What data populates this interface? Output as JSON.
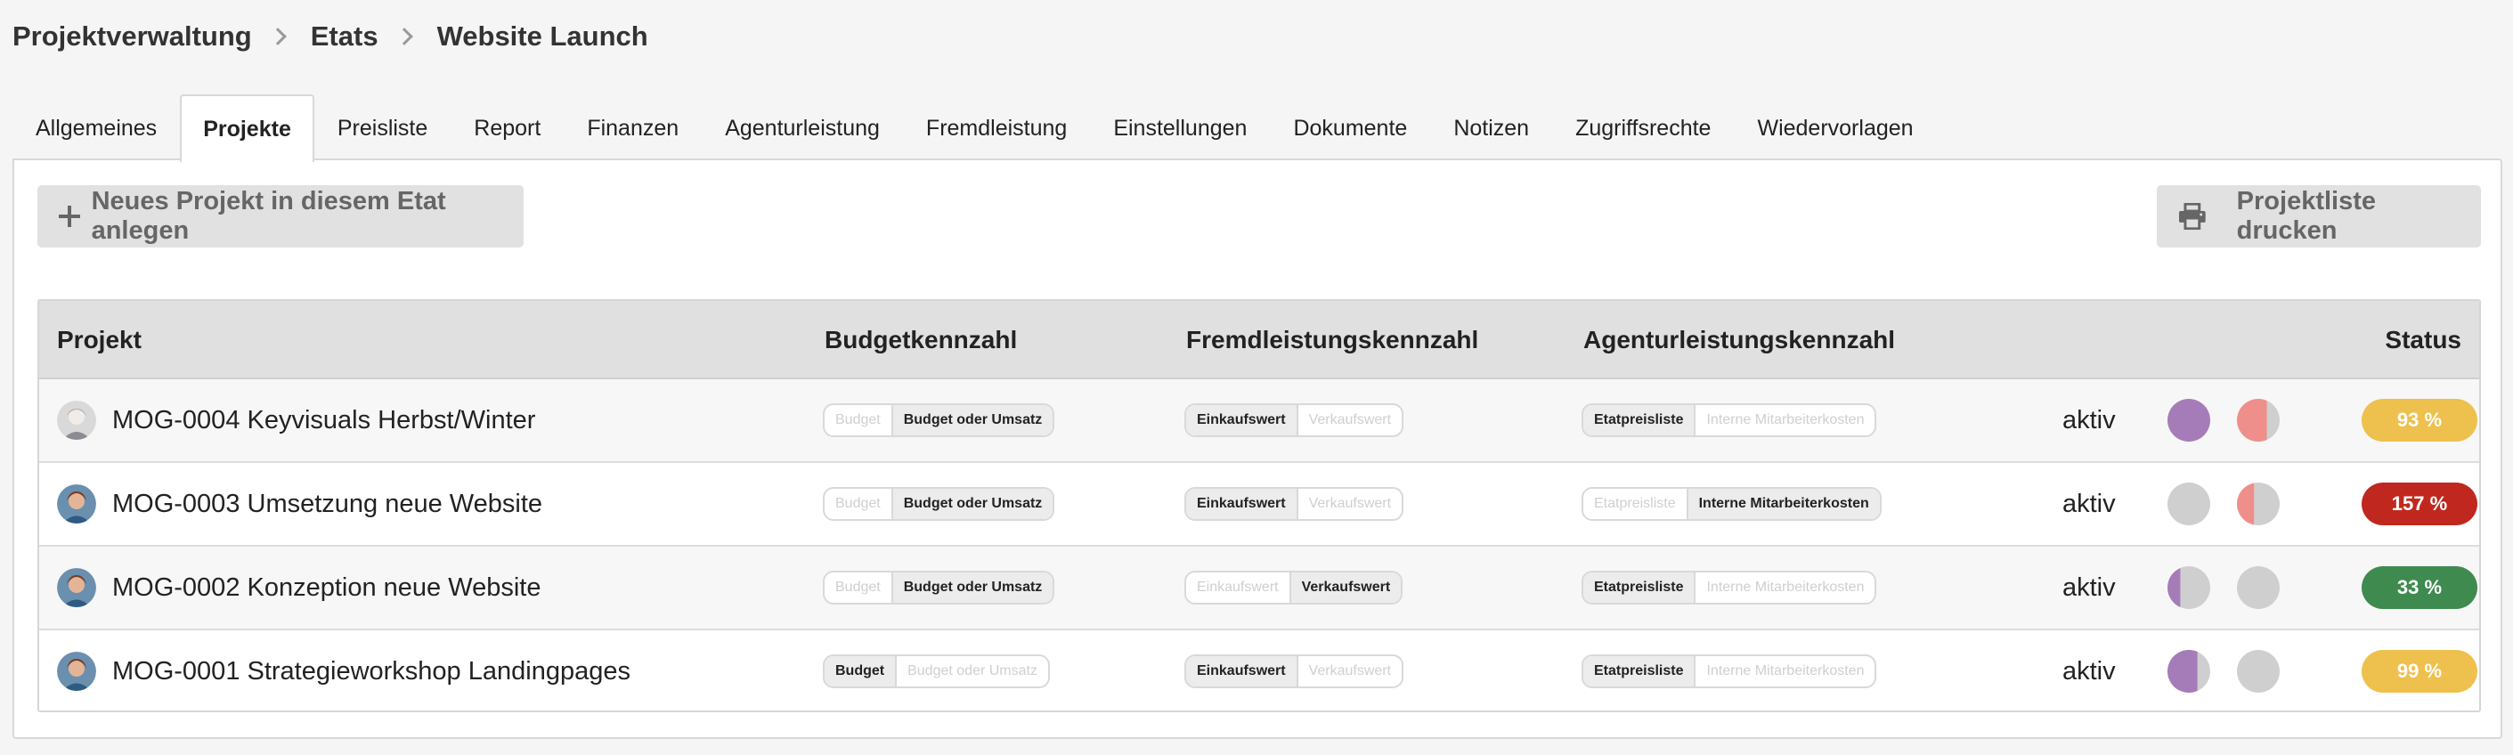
{
  "breadcrumb": [
    "Projektverwaltung",
    "Etats",
    "Website Launch"
  ],
  "tabs": [
    "Allgemeines",
    "Projekte",
    "Preisliste",
    "Report",
    "Finanzen",
    "Agenturleistung",
    "Fremdleistung",
    "Einstellungen",
    "Dokumente",
    "Notizen",
    "Zugriffsrechte",
    "Wiedervorlagen"
  ],
  "active_tab": "Projekte",
  "buttons": {
    "new_project": "Neues Projekt in diesem Etat anlegen",
    "print_list": "Projektliste drucken"
  },
  "table": {
    "headers": {
      "project": "Projekt",
      "budget": "Budgetkennzahl",
      "external": "Fremdleistungskennzahl",
      "agency": "Agenturleistungskennzahl",
      "status": "Status"
    },
    "rows": [
      {
        "name": "MOG-0004 Keyvisuals Herbst/Winter",
        "budget": [
          "Budget",
          "Budget oder Umsatz"
        ],
        "budget_on": 1,
        "external": [
          "Einkaufswert",
          "Verkaufswert"
        ],
        "external_on": 0,
        "agency": [
          "Etatpreisliste",
          "Interne Mitarbeiterkosten"
        ],
        "agency_on": 0,
        "state": "aktiv",
        "circle1_fill": 1.0,
        "circle1_color": "#a57cb8",
        "circle2_fill": 0.7,
        "circle2_color": "#ef8f8b",
        "status": "93 %",
        "status_color": "#eec04d",
        "avatar": "grey"
      },
      {
        "name": "MOG-0003 Umsetzung neue Website",
        "budget": [
          "Budget",
          "Budget oder Umsatz"
        ],
        "budget_on": 1,
        "external": [
          "Einkaufswert",
          "Verkaufswert"
        ],
        "external_on": 0,
        "agency": [
          "Etatpreisliste",
          "Interne Mitarbeiterkosten"
        ],
        "agency_on": 1,
        "state": "aktiv",
        "circle1_fill": 0.0,
        "circle1_color": "#a57cb8",
        "circle2_fill": 0.4,
        "circle2_color": "#ef8f8b",
        "status": "157 %",
        "status_color": "#c0281f",
        "avatar": "color"
      },
      {
        "name": "MOG-0002 Konzeption neue Website",
        "budget": [
          "Budget",
          "Budget oder Umsatz"
        ],
        "budget_on": 1,
        "external": [
          "Einkaufswert",
          "Verkaufswert"
        ],
        "external_on": 1,
        "agency": [
          "Etatpreisliste",
          "Interne Mitarbeiterkosten"
        ],
        "agency_on": 0,
        "state": "aktiv",
        "circle1_fill": 0.3,
        "circle1_color": "#a57cb8",
        "circle2_fill": 0.0,
        "circle2_color": "#ef8f8b",
        "status": "33 %",
        "status_color": "#3f8a4f",
        "avatar": "color"
      },
      {
        "name": "MOG-0001 Strategieworkshop Landingpages",
        "budget": [
          "Budget",
          "Budget oder Umsatz"
        ],
        "budget_on": 0,
        "external": [
          "Einkaufswert",
          "Verkaufswert"
        ],
        "external_on": 0,
        "agency": [
          "Etatpreisliste",
          "Interne Mitarbeiterkosten"
        ],
        "agency_on": 0,
        "state": "aktiv",
        "circle1_fill": 0.7,
        "circle1_color": "#a57cb8",
        "circle2_fill": 0.0,
        "circle2_color": "#ef8f8b",
        "status": "99 %",
        "status_color": "#eec04d",
        "avatar": "color"
      }
    ]
  },
  "colors": {
    "circle_empty": "#cfcfcf"
  }
}
